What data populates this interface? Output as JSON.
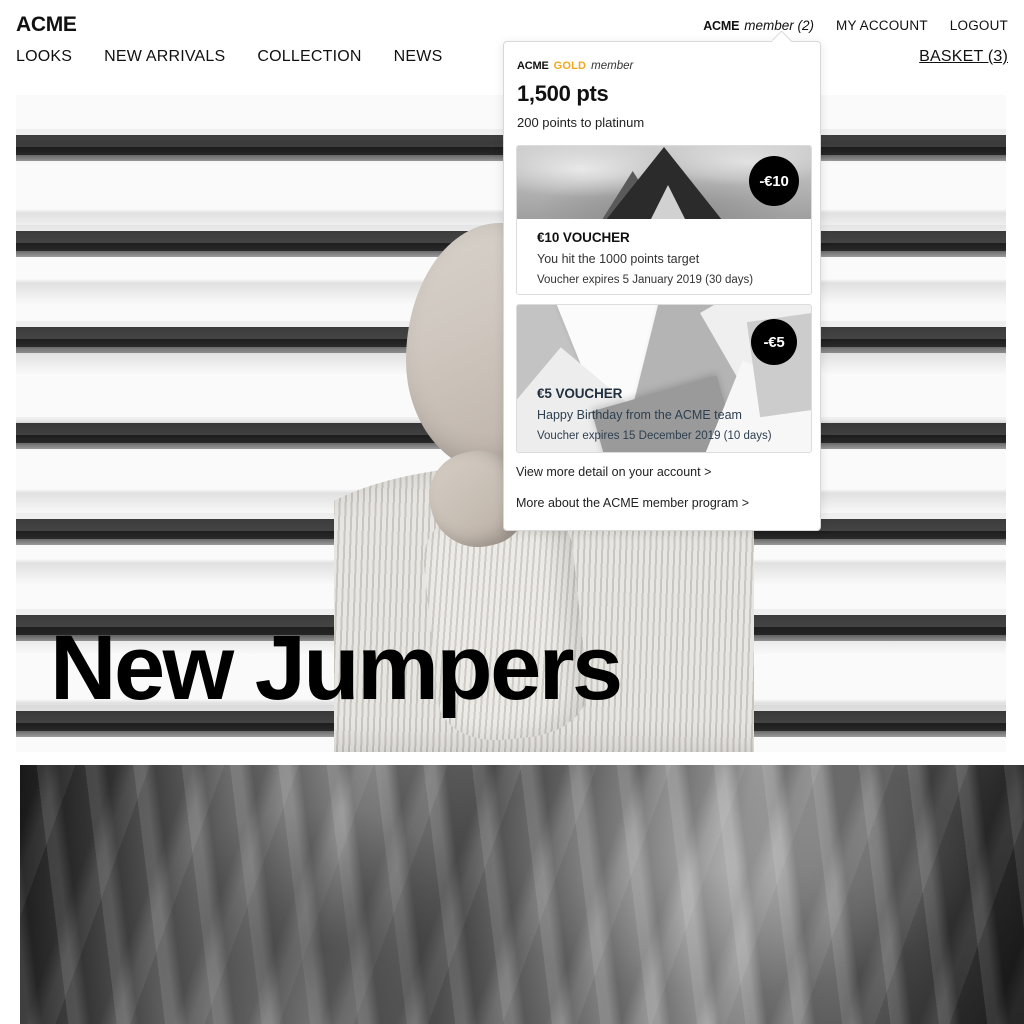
{
  "header": {
    "logo": "ACME",
    "utility": {
      "member_brand": "ACME",
      "member_text": "member (2)",
      "my_account": "MY ACCOUNT",
      "logout": "LOGOUT"
    },
    "nav": [
      {
        "label": "LOOKS"
      },
      {
        "label": "NEW ARRIVALS"
      },
      {
        "label": "COLLECTION"
      },
      {
        "label": "NEWS"
      }
    ],
    "basket": "BASKET (3)"
  },
  "hero": {
    "title": "New Jumpers"
  },
  "member_panel": {
    "tier_brand": "ACME",
    "tier_name": "GOLD",
    "tier_suffix": "member",
    "points": "1,500 pts",
    "points_sub": "200 points to platinum",
    "vouchers": [
      {
        "badge": "-€10",
        "title": "€10 VOUCHER",
        "description": "You hit the 1000 points target",
        "expiry": "Voucher expires 5 January 2019 (30 days)"
      },
      {
        "badge": "-€5",
        "title": "€5 VOUCHER",
        "description": "Happy Birthday from the ACME team",
        "expiry": "Voucher expires 15 December 2019 (10 days)"
      }
    ],
    "links": [
      {
        "label": "View more detail on your account >"
      },
      {
        "label": "More about the ACME member program >"
      }
    ]
  },
  "colors": {
    "gold": "#f0a81e",
    "text": "#111111",
    "badge_bg": "#000000",
    "voucher_b_text": "#21303f"
  }
}
